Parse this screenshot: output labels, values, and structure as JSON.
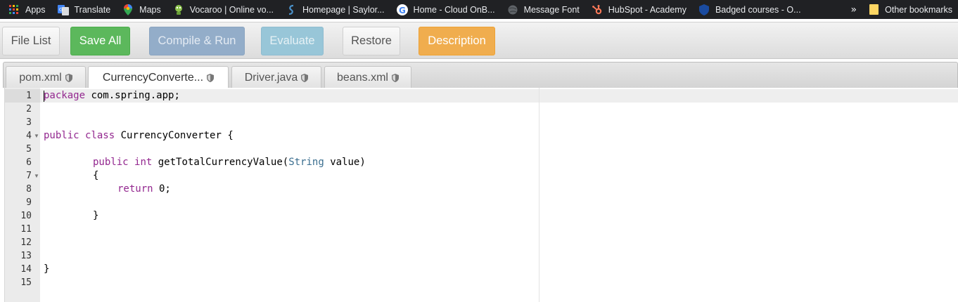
{
  "bookmarks": [
    {
      "label": "Apps",
      "icon": "apps-grid-icon"
    },
    {
      "label": "Translate",
      "icon": "google-translate-icon"
    },
    {
      "label": "Maps",
      "icon": "maps-pin-icon"
    },
    {
      "label": "Vocaroo | Online vo...",
      "icon": "vocaroo-icon"
    },
    {
      "label": "Homepage | Saylor...",
      "icon": "saylor-icon"
    },
    {
      "label": "Home - Cloud OnB...",
      "icon": "google-g-icon"
    },
    {
      "label": "Message Font",
      "icon": "globe-icon"
    },
    {
      "label": "HubSpot - Academy",
      "icon": "hubspot-icon"
    },
    {
      "label": "Badged courses - O...",
      "icon": "badge-shield-icon"
    }
  ],
  "bookmarks_overflow": "»",
  "other_bookmarks": "Other bookmarks",
  "toolbar": {
    "file_list": "File List",
    "save_all": "Save All",
    "compile_run": "Compile & Run",
    "evaluate": "Evaluate",
    "restore": "Restore",
    "description": "Description"
  },
  "tabs": [
    {
      "label": "pom.xml",
      "active": false
    },
    {
      "label": "CurrencyConverte...",
      "active": true
    },
    {
      "label": "Driver.java",
      "active": false
    },
    {
      "label": "beans.xml",
      "active": false
    }
  ],
  "line_numbers": [
    "1",
    "2",
    "3",
    "4",
    "5",
    "6",
    "7",
    "8",
    "9",
    "10",
    "11",
    "12",
    "13",
    "14",
    "15"
  ],
  "code": {
    "l1_kw": "package",
    "l1_rest": " com.spring.app;",
    "l4_kw1": "public",
    "l4_kw2": "class",
    "l4_rest": " CurrencyConverter {",
    "l6_kw1": "public",
    "l6_kw2": "int",
    "l6_mid": " getTotalCurrencyValue(",
    "l6_type": "String",
    "l6_end": " value)",
    "l7": "{",
    "l8_kw": "return",
    "l8_rest": " 0;",
    "l10": "}",
    "l14": "}"
  },
  "colors": {
    "bookmarks_bg": "#202124",
    "save_all": "#5cb85c",
    "compile_run": "#93adc9",
    "evaluate": "#98c6d8",
    "description": "#f0ad4e",
    "keyword": "#93278f"
  }
}
